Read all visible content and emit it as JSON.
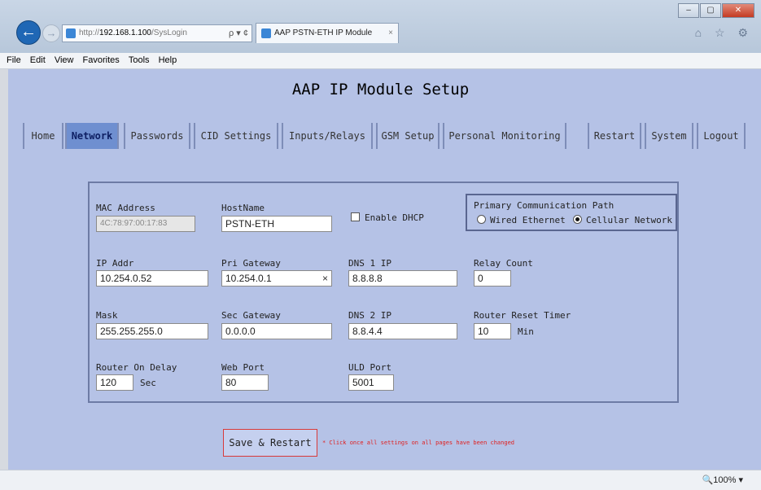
{
  "browser": {
    "address_proto": "http://",
    "address_host": "192.168.1.100",
    "address_path": "/SysLogin",
    "address_controls": "ρ ▾ ¢",
    "tab_title": "AAP PSTN-ETH IP Module",
    "tab_close": "×",
    "window_controls": [
      "–",
      "▢",
      "✕"
    ],
    "toolbar_icons": "⌂ ☆ ⚙",
    "menu": [
      "File",
      "Edit",
      "View",
      "Favorites",
      "Tools",
      "Help"
    ],
    "zoom": "🔍100%  ▾"
  },
  "page": {
    "title": "AAP IP Module Setup",
    "nav": [
      "Home",
      "Network",
      "Passwords",
      "CID Settings",
      "Inputs/Relays",
      "GSM Setup",
      "Personal Monitoring",
      "Restart",
      "System",
      "Logout"
    ],
    "active_nav": "Network"
  },
  "form": {
    "mac_label": "MAC Address",
    "mac_value": "4C:78:97:00:17:83",
    "hostname_label": "HostName",
    "hostname_value": "PSTN-ETH",
    "dhcp_label": "Enable DHCP",
    "comm_path_label": "Primary Communication Path",
    "comm_opt_wired": "Wired Ethernet",
    "comm_opt_cellular": "Cellular Network",
    "comm_selected": "Cellular Network",
    "ip_label": "IP Addr",
    "ip_value": "10.254.0.52",
    "pri_gw_label": "Pri Gateway",
    "pri_gw_value": "10.254.0.1",
    "pri_gw_clear": "×",
    "dns1_label": "DNS 1 IP",
    "dns1_value": "8.8.8.8",
    "relay_label": "Relay Count",
    "relay_value": "0",
    "mask_label": "Mask",
    "mask_value": "255.255.255.0",
    "sec_gw_label": "Sec Gateway",
    "sec_gw_value": "0.0.0.0",
    "dns2_label": "DNS 2 IP",
    "dns2_value": "8.8.4.4",
    "reset_label": "Router Reset Timer",
    "reset_value": "10",
    "reset_unit": "Min",
    "ondelay_label": "Router On Delay",
    "ondelay_value": "120",
    "ondelay_unit": "Sec",
    "web_label": "Web Port",
    "web_value": "80",
    "uld_label": "ULD Port",
    "uld_value": "5001"
  },
  "actions": {
    "save_label": "Save & Restart",
    "save_note": "* Click once all settings on all pages have been changed"
  }
}
